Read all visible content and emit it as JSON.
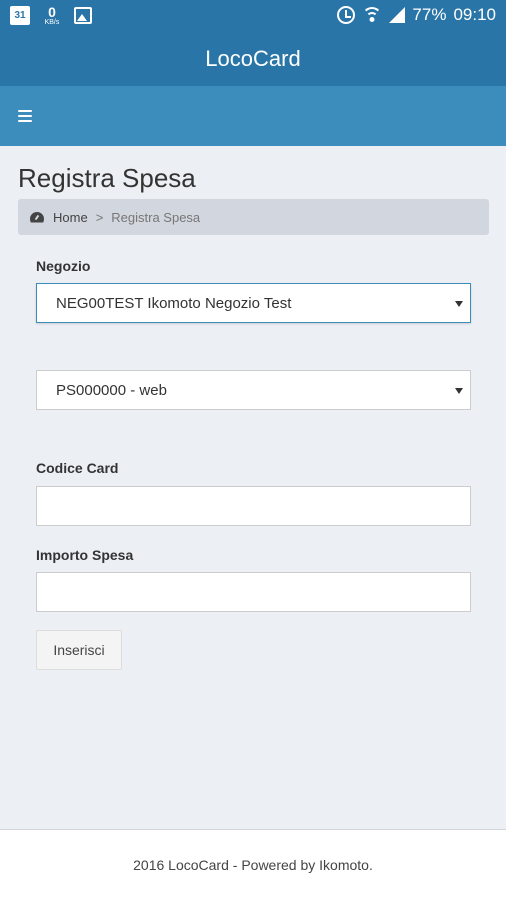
{
  "status_bar": {
    "calendar_day": "31",
    "net_speed": "0",
    "net_unit": "KB/s",
    "battery": "77%",
    "time": "09:10",
    "icons": [
      "calendar-icon",
      "network-speed-icon",
      "image-icon",
      "alarm-icon",
      "wifi-icon",
      "signal-icon"
    ]
  },
  "header": {
    "title": "LocoCard"
  },
  "nav": {
    "menu_icon": "hamburger-icon"
  },
  "page": {
    "title": "Registra Spesa"
  },
  "breadcrumb": {
    "icon": "dashboard-icon",
    "home": "Home",
    "separator": ">",
    "current": "Registra Spesa"
  },
  "form": {
    "store_label": "Negozio",
    "store_value": "NEG00TEST Ikomoto Negozio Test",
    "pos_value": "PS000000 - web",
    "card_label": "Codice Card",
    "card_value": "",
    "amount_label": "Importo Spesa",
    "amount_value": "",
    "submit_label": "Inserisci"
  },
  "footer": {
    "text": "2016 LocoCard - Powered by Ikomoto."
  },
  "colors": {
    "primary_dark": "#2a75a8",
    "primary": "#3c8dbc",
    "background": "#ecf0f5",
    "breadcrumb_bg": "#d2d6de"
  }
}
